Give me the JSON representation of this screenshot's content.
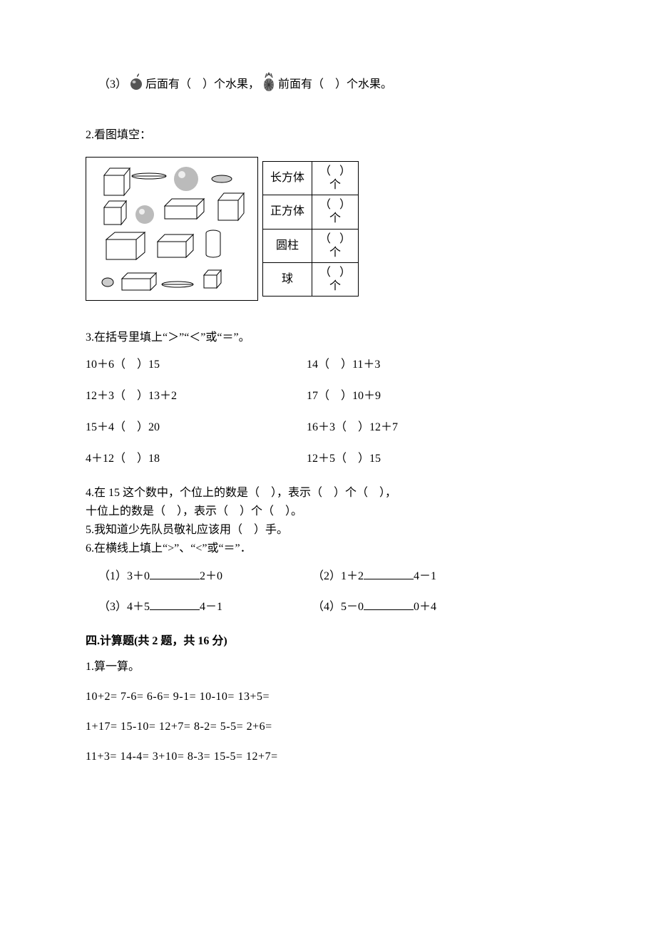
{
  "q1_sub3": {
    "prefix": "（3）",
    "partA_mid": "后面有（    ）个水果，",
    "partB_mid": "前面有（    ）个水果。"
  },
  "q2": {
    "label": "2.看图填空："
  },
  "shape_table": {
    "rows": [
      {
        "name": "长方体",
        "count": "（   ）\n个"
      },
      {
        "name": "正方体",
        "count": "（   ）\n个"
      },
      {
        "name": "圆柱",
        "count": "（   ）\n个"
      },
      {
        "name": "球",
        "count": "（   ）\n个"
      }
    ]
  },
  "q3": {
    "label": "3.在括号里填上“＞”“＜”或“＝”。",
    "rows": [
      [
        "10＋6（    ）15",
        "14（    ）11＋3"
      ],
      [
        "12＋3（    ）13＋2",
        "17（    ）10＋9"
      ],
      [
        "15＋4（    ）20",
        "16＋3（    ）12＋7"
      ],
      [
        "4＋12（    ）18",
        "12＋5（    ）15"
      ]
    ]
  },
  "q4": {
    "l1": "4.在 15 这个数中，个位上的数是（    ），表示（    ）个（    ），",
    "l2": "十位上的数是（    ），表示（    ）个（    ）。"
  },
  "q5": {
    "text": "5.我知道少先队员敬礼应该用（    ）手。"
  },
  "q6": {
    "label": "6.在横线上填上“>”、“<”或“＝”．",
    "rows": [
      {
        "a_pre": "（1）3＋0",
        "a_post": "2＋0",
        "b_pre": "（2）1＋2",
        "b_post": "4－1"
      },
      {
        "a_pre": "（3）4＋5",
        "a_post": "4－1",
        "b_pre": "（4）5－0",
        "b_post": "0＋4"
      }
    ]
  },
  "section4": {
    "title": "四.计算题(共 2 题，共 16 分)"
  },
  "calc": {
    "label": "1.算一算。",
    "lines": [
      "10+2= 7-6= 6-6= 9-1= 10-10= 13+5=",
      "1+17= 15-10= 12+7= 8-2= 5-5= 2+6=",
      "11+3= 14-4= 3+10= 8-3= 15-5= 12+7="
    ]
  }
}
